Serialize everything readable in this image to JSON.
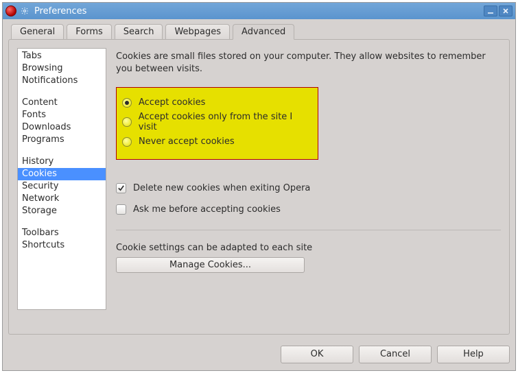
{
  "window": {
    "title": "Preferences"
  },
  "tabs": {
    "items": [
      "General",
      "Forms",
      "Search",
      "Webpages",
      "Advanced"
    ],
    "active_index": 4
  },
  "sidebar": {
    "groups": [
      [
        "Tabs",
        "Browsing",
        "Notifications"
      ],
      [
        "Content",
        "Fonts",
        "Downloads",
        "Programs"
      ],
      [
        "History",
        "Cookies",
        "Security",
        "Network",
        "Storage"
      ],
      [
        "Toolbars",
        "Shortcuts"
      ]
    ],
    "selected": "Cookies"
  },
  "main": {
    "description": "Cookies are small files stored on your computer. They allow websites to remember you between visits.",
    "radios": {
      "items": [
        "Accept cookies",
        "Accept cookies only from the site I visit",
        "Never accept cookies"
      ],
      "selected_index": 0
    },
    "checks": {
      "delete_on_exit": {
        "label": "Delete new cookies when exiting Opera",
        "checked": true
      },
      "ask_before": {
        "label": "Ask me before accepting cookies",
        "checked": false
      }
    },
    "per_site_label": "Cookie settings can be adapted to each site",
    "manage_button": "Manage Cookies..."
  },
  "footer": {
    "ok": "OK",
    "cancel": "Cancel",
    "help": "Help"
  }
}
